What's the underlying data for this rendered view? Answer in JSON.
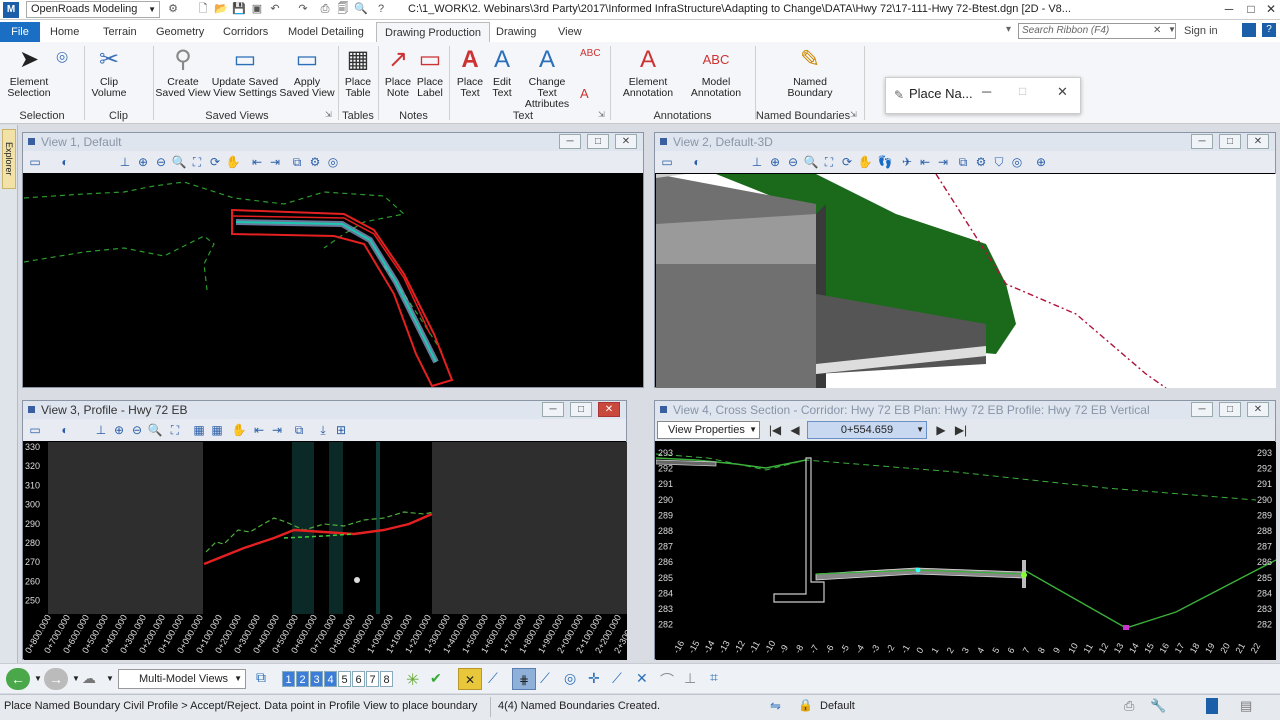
{
  "titlebar": {
    "workspace": "OpenRoads Modeling",
    "path": "C:\\1_WORK\\2. Webinars\\3rd Party\\2017\\Informed InfraStructure\\Adapting to Change\\DATA\\Hwy 72\\17-111-Hwy 72-Btest.dgn [2D - V8..."
  },
  "tabs": [
    "File",
    "Home",
    "Terrain",
    "Geometry",
    "Corridors",
    "Model Detailing",
    "Drawing Production",
    "Drawing",
    "View"
  ],
  "search": {
    "placeholder": "Search Ribbon (F4)"
  },
  "signin": "Sign in",
  "ribbon": {
    "buttons": [
      {
        "label": "Element\nSelection"
      },
      {
        "label": "Clip\nVolume"
      },
      {
        "label": "Create\nSaved View"
      },
      {
        "label": "Update Saved\nView Settings"
      },
      {
        "label": "Apply\nSaved View"
      },
      {
        "label": "Place\nTable"
      },
      {
        "label": "Place\nNote"
      },
      {
        "label": "Place\nLabel"
      },
      {
        "label": "Place\nText"
      },
      {
        "label": "Edit\nText"
      },
      {
        "label": "Change Text\nAttributes"
      },
      {
        "label": "Element\nAnnotation"
      },
      {
        "label": "Model\nAnnotation"
      },
      {
        "label": "Named\nBoundary"
      }
    ],
    "groups": [
      "Selection",
      "Clip",
      "Saved Views",
      "Tables",
      "Notes",
      "Text",
      "Annotations",
      "Named Boundaries"
    ]
  },
  "dialog": {
    "title": "Place Na..."
  },
  "views": {
    "v1": {
      "title": "View 1, Default"
    },
    "v2": {
      "title": "View 2, Default-3D"
    },
    "v3": {
      "title": "View 3, Profile - Hwy 72 EB",
      "yticks": [
        "330",
        "320",
        "310",
        "300",
        "290",
        "280",
        "270",
        "260",
        "250"
      ]
    },
    "v4": {
      "title": "View 4, Cross Section - Corridor: Hwy 72 EB Plan: Hwy 72 EB Profile: Hwy 72 EB Vertical",
      "view_properties": "View Properties",
      "station": "0+554.659",
      "yticks": [
        "293",
        "292",
        "291",
        "290",
        "289",
        "288",
        "287",
        "286",
        "285",
        "284",
        "283",
        "282"
      ]
    }
  },
  "v3_xticks": [
    "0+800.000",
    "0+700.000",
    "0+600.000",
    "0+500.000",
    "0+400.000",
    "0+300.000",
    "0+200.000",
    "0+100.000",
    "0+000.000",
    "0+100.000",
    "0+200.000",
    "0+300.000",
    "0+400.000",
    "0+500.000",
    "0+600.000",
    "0+700.000",
    "0+800.000",
    "0+900.000",
    "1+000.000",
    "1+100.000",
    "1+200.000",
    "1+300.000",
    "1+400.000",
    "1+500.000",
    "1+600.000",
    "1+700.000",
    "1+800.000",
    "1+900.000",
    "2+000.000",
    "2+100.000",
    "2+200.000",
    "2+300.000"
  ],
  "v4_xticks": [
    "-16",
    "-15",
    "-14",
    "-13",
    "-12",
    "-11",
    "-10",
    "-9",
    "-8",
    "-7",
    "-6",
    "-5",
    "-4",
    "-3",
    "-2",
    "-1",
    "0",
    "1",
    "2",
    "3",
    "4",
    "5",
    "6",
    "7",
    "8",
    "9",
    "10",
    "11",
    "12",
    "13",
    "14",
    "15",
    "16",
    "17",
    "18",
    "19",
    "20",
    "21",
    "22"
  ],
  "bottombar": {
    "multimodel": "Multi-Model Views",
    "view_numbers": [
      "1",
      "2",
      "3",
      "4",
      "5",
      "6",
      "7",
      "8"
    ]
  },
  "status": {
    "prompt": "Place Named Boundary Civil Profile > Accept/Reject. Data point in Profile View to place boundary",
    "message": "4(4) Named Boundaries Created.",
    "level": "Default"
  }
}
